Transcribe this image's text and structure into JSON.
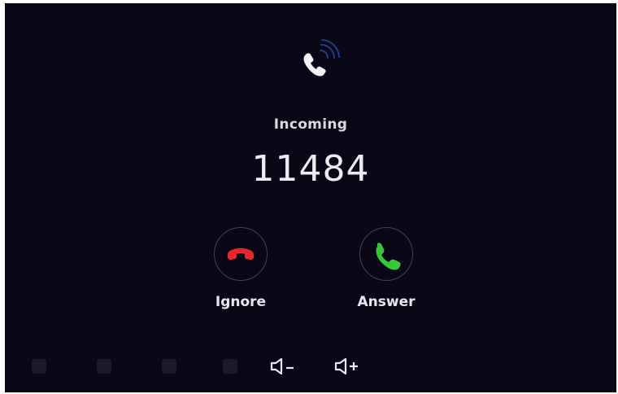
{
  "call": {
    "status_label": "Incoming",
    "caller_number": "11484"
  },
  "actions": {
    "ignore_label": "Ignore",
    "answer_label": "Answer"
  },
  "icons": {
    "header": "phone-ringing-icon",
    "ignore": "phone-hangup-icon",
    "answer": "phone-answer-icon",
    "volume_down": "volume-down-icon",
    "volume_up": "volume-up-icon"
  },
  "colors": {
    "background": "#0a0717",
    "ignore_accent": "#e8262a",
    "answer_accent": "#35c83b",
    "button_ring": "#3b4566",
    "text": "#e7e7ee"
  }
}
